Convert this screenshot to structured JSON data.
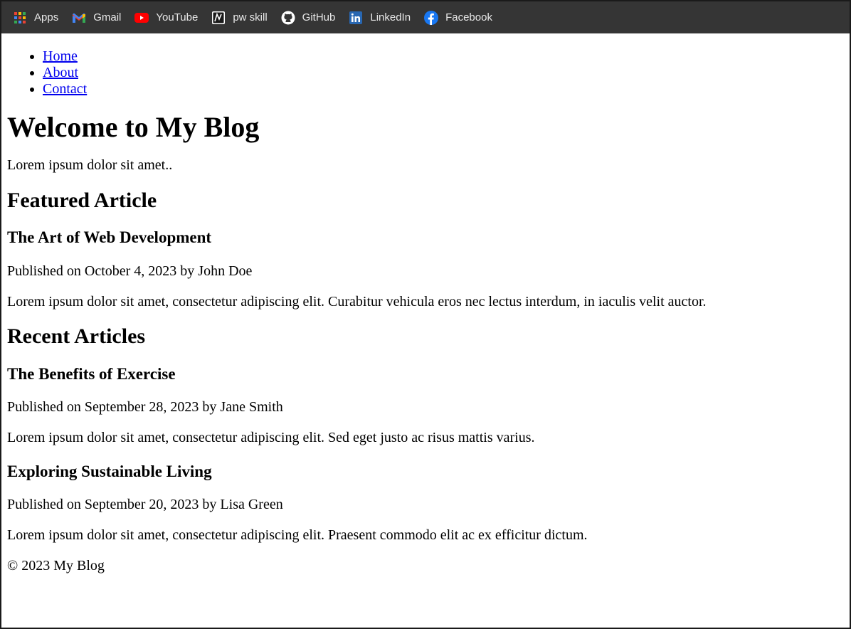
{
  "bookmarks": [
    {
      "label": "Apps",
      "icon": "apps-grid-icon"
    },
    {
      "label": "Gmail",
      "icon": "gmail-icon"
    },
    {
      "label": "YouTube",
      "icon": "youtube-icon"
    },
    {
      "label": "pw skill",
      "icon": "pw-skill-icon"
    },
    {
      "label": "GitHub",
      "icon": "github-icon"
    },
    {
      "label": "LinkedIn",
      "icon": "linkedin-icon"
    },
    {
      "label": "Facebook",
      "icon": "facebook-icon"
    }
  ],
  "nav": [
    "Home",
    "About",
    "Contact"
  ],
  "page": {
    "title": "Welcome to My Blog",
    "intro": "Lorem ipsum dolor sit amet.."
  },
  "featured": {
    "heading": "Featured Article",
    "title": "The Art of Web Development",
    "meta": "Published on October 4, 2023 by John Doe",
    "body": "Lorem ipsum dolor sit amet, consectetur adipiscing elit. Curabitur vehicula eros nec lectus interdum, in iaculis velit auctor."
  },
  "recent": {
    "heading": "Recent Articles",
    "articles": [
      {
        "title": "The Benefits of Exercise",
        "meta": "Published on September 28, 2023 by Jane Smith",
        "body": "Lorem ipsum dolor sit amet, consectetur adipiscing elit. Sed eget justo ac risus mattis varius."
      },
      {
        "title": "Exploring Sustainable Living",
        "meta": "Published on September 20, 2023 by Lisa Green",
        "body": "Lorem ipsum dolor sit amet, consectetur adipiscing elit. Praesent commodo elit ac ex efficitur dictum."
      }
    ]
  },
  "footer": "© 2023 My Blog",
  "colors": {
    "bookmark_bar_bg": "#353535",
    "link": "#0000ee"
  }
}
